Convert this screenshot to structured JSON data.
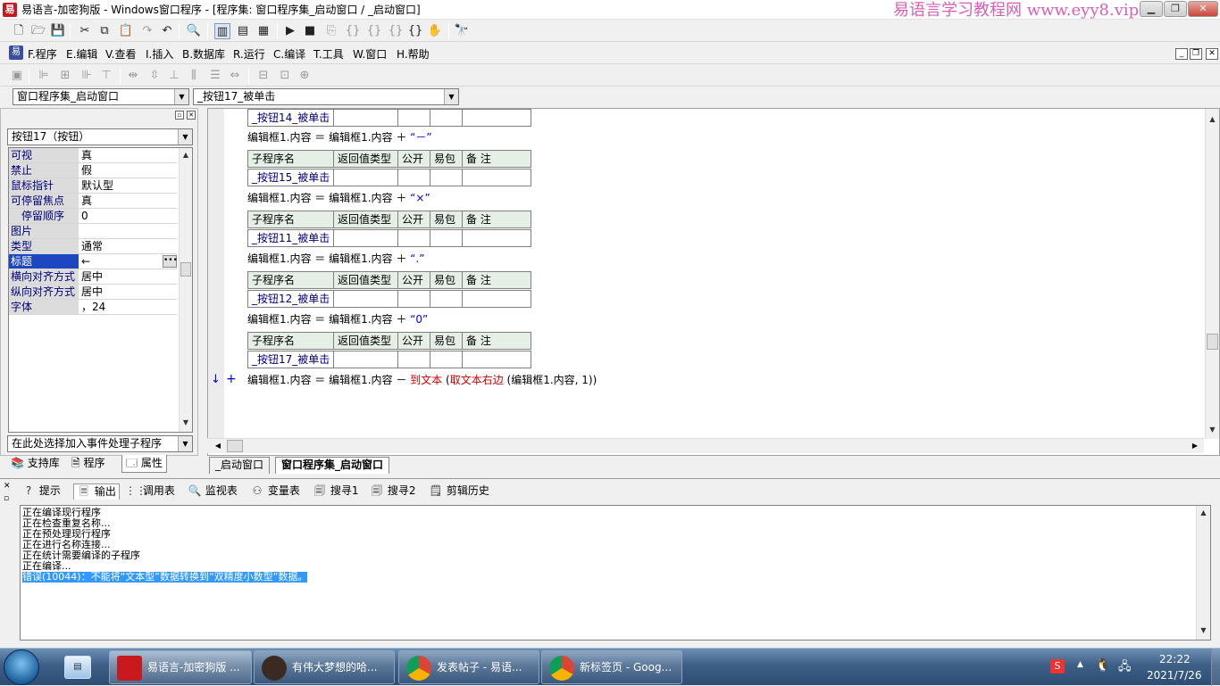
{
  "window": {
    "title": "易语言-加密狗版 - Windows窗口程序 - [程序集: 窗口程序集_启动窗口 / _启动窗口]",
    "watermark": "易语言学习教程网 www.eyy8.vip"
  },
  "menu": {
    "items": [
      "F.程序",
      "E.编辑",
      "V.查看",
      "I.插入",
      "B.数据库",
      "R.运行",
      "C.编译",
      "T.工具",
      "W.窗口",
      "H.帮助"
    ]
  },
  "selectors": {
    "program_set": "窗口程序集_启动窗口",
    "subroutine": "_按钮17_被单击"
  },
  "left_panel": {
    "component_combo": "按钮17（按钮）",
    "properties": [
      {
        "name": "可视",
        "value": "真"
      },
      {
        "name": "禁止",
        "value": "假"
      },
      {
        "name": "鼠标指针",
        "value": "默认型"
      },
      {
        "name": "可停留焦点",
        "value": "真"
      },
      {
        "name": "停留顺序",
        "value": "0"
      },
      {
        "name": "图片",
        "value": ""
      },
      {
        "name": "类型",
        "value": "通常"
      },
      {
        "name": "标题",
        "value": "←"
      },
      {
        "name": "横向对齐方式",
        "value": "居中"
      },
      {
        "name": "纵向对齐方式",
        "value": "居中"
      },
      {
        "name": "字体",
        "value": "，24"
      }
    ],
    "event_combo": "在此处选择加入事件处理子程序",
    "tabs": [
      "支持库",
      "程序",
      "属性"
    ]
  },
  "editor": {
    "table_headers": [
      "子程序名",
      "返回值类型",
      "公开",
      "易包",
      "备 注"
    ],
    "top_sub": "_按钮14_被单击",
    "blocks": [
      {
        "code_prefix": "编辑框1.内容 ＝ 编辑框1.内容 ＋ ",
        "literal": "“－”"
      },
      {
        "sub": "_按钮15_被单击",
        "code_prefix": "编辑框1.内容 ＝ 编辑框1.内容 ＋ ",
        "literal": "“×”"
      },
      {
        "sub": "_按钮11_被单击",
        "code_prefix": "编辑框1.内容 ＝ 编辑框1.内容 ＋ ",
        "literal": "“.”"
      },
      {
        "sub": "_按钮12_被单击",
        "code_prefix": "编辑框1.内容 ＝ 编辑框1.内容 ＋ ",
        "literal": "“0”"
      },
      {
        "sub": "_按钮17_被单击"
      }
    ],
    "last_line": {
      "a": "编辑框1.内容 ＝ 编辑框1.内容 － ",
      "b": "到文本",
      "c": " (",
      "d": "取文本右边",
      "e": " (编辑框1.内容, 1))"
    },
    "gutter_marks": {
      "arrow": "↓",
      "plus": "+"
    },
    "tabs": [
      "_启动窗口",
      "窗口程序集_启动窗口"
    ]
  },
  "bottom": {
    "tabs": [
      "提示",
      "输出",
      "调用表",
      "监视表",
      "变量表",
      "搜寻1",
      "搜寻2",
      "剪辑历史"
    ],
    "output_lines": [
      "正在编译现行程序",
      "正在检查重复名称...",
      "正在预处理现行程序",
      "正在进行名称连接...",
      "正在统计需要编译的子程序",
      "正在编译..."
    ],
    "error_line": "错误(10044)：不能将“文本型”数据转换到“双精度小数型”数据。"
  },
  "taskbar": {
    "tasks": [
      "易语言-加密狗版 ...",
      "有伟大梦想的哈...",
      "发表帖子 - 易语...",
      "新标签页 - Goog..."
    ],
    "clock_time": "22:22",
    "clock_date": "2021/7/26"
  },
  "colors": {
    "keyword_blue": "#0000ff",
    "function_red": "#c80000",
    "selection": "#3399ff"
  }
}
